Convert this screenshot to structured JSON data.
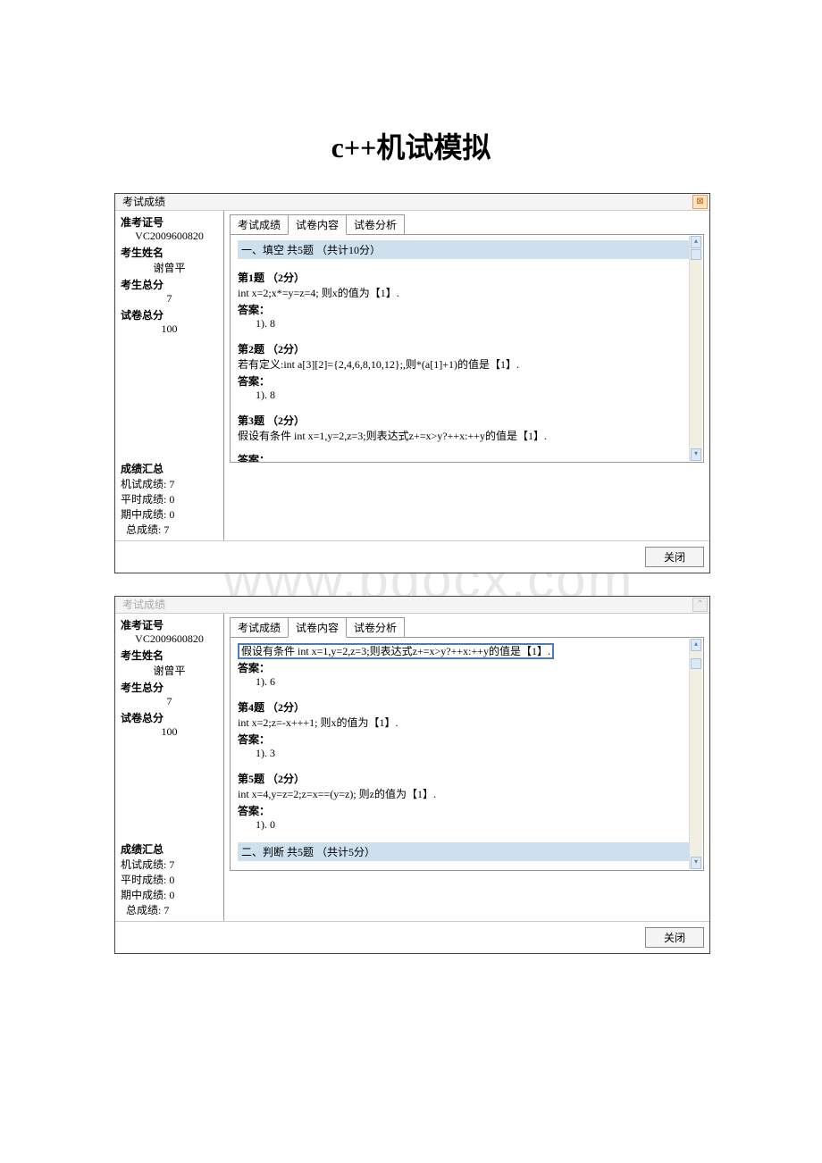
{
  "page_title": "c++机试模拟",
  "watermark": "www.bdocx.com",
  "window1": {
    "title": "考试成绩",
    "close_glyph": "⊠",
    "sidebar": {
      "id_label": "准考证号",
      "id_value": "VC2009600820",
      "name_label": "考生姓名",
      "name_value": "谢曾平",
      "score_label": "考生总分",
      "score_value": "7",
      "paper_label": "试卷总分",
      "paper_value": "100",
      "summary_title": "成绩汇总",
      "summary": {
        "l1": "机试成绩: 7",
        "l2": "平时成绩: 0",
        "l3": "期中成绩: 0",
        "l4": "总成绩: 7"
      }
    },
    "tabs": {
      "t1": "考试成绩",
      "t2": "试卷内容",
      "t3": "试卷分析"
    },
    "section_header": "一、填空  共5题  （共计10分）",
    "q1": {
      "title": "第1题 （2分）",
      "body": "int x=2;x*=y=z=4; 则x的值为【1】.",
      "ans_label": "答案：",
      "ans": "1). 8"
    },
    "q2": {
      "title": "第2题 （2分）",
      "body": "若有定义:int a[3][2]={2,4,6,8,10,12};,则*(a[1]+1)的值是【1】.",
      "ans_label": "答案：",
      "ans": "1). 8"
    },
    "q3": {
      "title": "第3题 （2分）",
      "body": "假设有条件 int x=1,y=2,z=3;则表达式z+=x>y?++x:++y的值是【1】.",
      "ans_label_cut": "答案："
    },
    "close_button": "关闭"
  },
  "window2": {
    "title": "考试成绩",
    "close_glyph": "⌃",
    "sidebar": {
      "id_label": "准考证号",
      "id_value": "VC2009600820",
      "name_label": "考生姓名",
      "name_value": "谢曾平",
      "score_label": "考生总分",
      "score_value": "7",
      "paper_label": "试卷总分",
      "paper_value": "100",
      "summary_title": "成绩汇总",
      "summary": {
        "l1": "机试成绩: 7",
        "l2": "平时成绩: 0",
        "l3": "期中成绩: 0",
        "l4": "总成绩: 7"
      }
    },
    "tabs": {
      "t1": "考试成绩",
      "t2": "试卷内容",
      "t3": "试卷分析"
    },
    "top_line": "假设有条件 int x=1,y=2,z=3;则表达式z+=x>y?++x:++y的值是【1】.",
    "q3": {
      "ans_label": "答案：",
      "ans": "1). 6"
    },
    "q4": {
      "title": "第4题 （2分）",
      "body": "int x=2;z=-x+++1; 则x的值为【1】.",
      "ans_label": "答案：",
      "ans": "1). 3"
    },
    "q5": {
      "title": "第5题 （2分）",
      "body": "int x=4,y=z=2;z=x==(y=z); 则z的值为【1】.",
      "ans_label": "答案：",
      "ans": "1). 0"
    },
    "section2_header": "二、判断  共5题  （共计5分）",
    "close_button": "关闭"
  }
}
